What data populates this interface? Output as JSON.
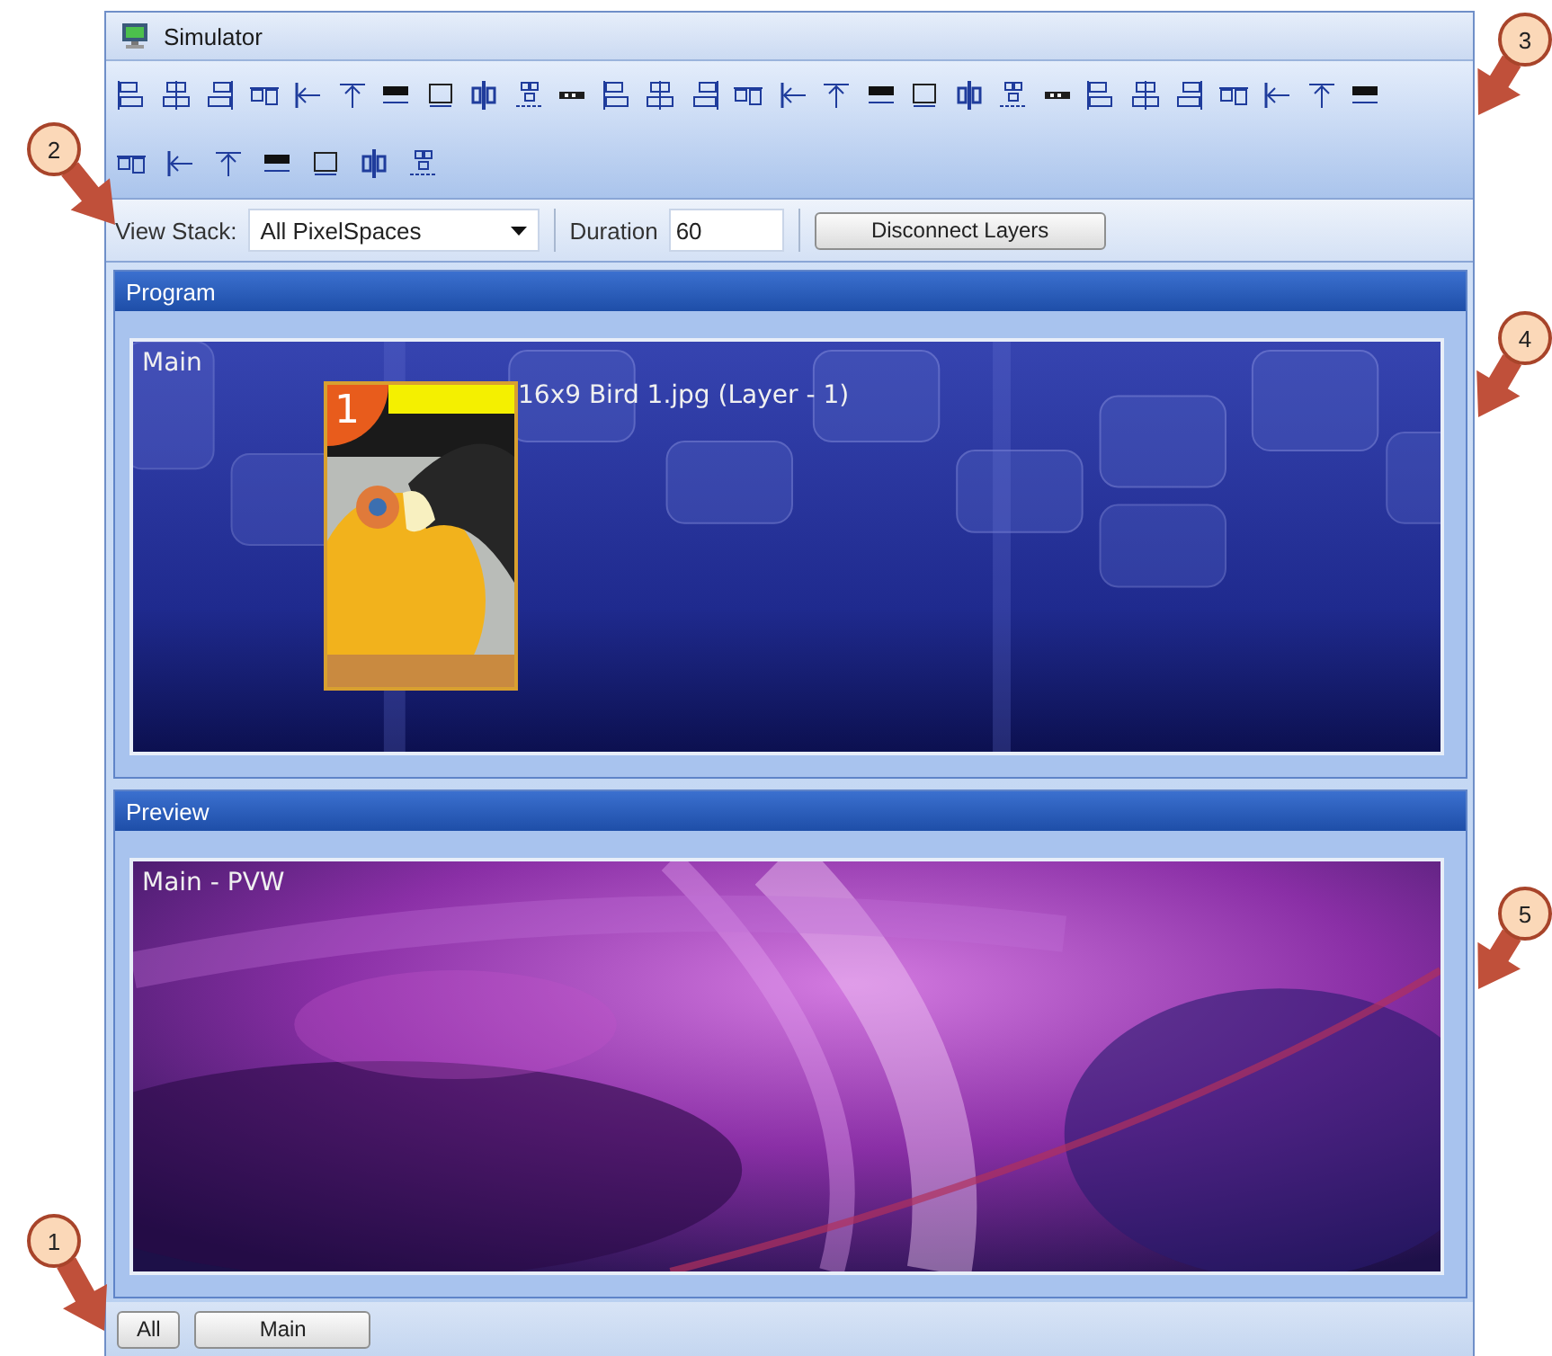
{
  "window": {
    "title": "Simulator"
  },
  "view_bar": {
    "view_stack_label": "View Stack:",
    "view_stack_value": "All PixelSpaces",
    "duration_label": "Duration",
    "duration_value": "60",
    "disconnect_button": "Disconnect Layers"
  },
  "panels": [
    {
      "title": "Program",
      "kind": "program",
      "screen_label": "Main",
      "layers": [
        {
          "number": "1",
          "name": "16x9 Bird 1.jpg (Layer - 1)"
        }
      ]
    },
    {
      "title": "Preview",
      "kind": "preview",
      "screen_label": "Main - PVW"
    }
  ],
  "bottom_buttons": [
    {
      "label": "All"
    },
    {
      "label": "Main"
    }
  ],
  "callouts": [
    {
      "number": "1"
    },
    {
      "number": "2"
    },
    {
      "number": "3"
    },
    {
      "number": "4"
    },
    {
      "number": "5"
    }
  ]
}
